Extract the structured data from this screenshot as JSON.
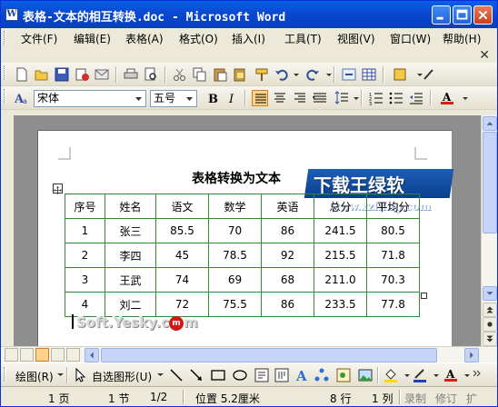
{
  "window": {
    "title": "表格-文本的相互转换.doc - Microsoft Word"
  },
  "menu": [
    "文件(F)",
    "编辑(E)",
    "视图(V)",
    "插入(I)",
    "格式(O)",
    "工具(T)",
    "表格(A)",
    "窗口(W)",
    "帮助(H)"
  ],
  "menu_order": [
    "文件(F)",
    "编辑(E)",
    "表格(A)",
    "格式(O)",
    "插入(I)",
    "工具(T)",
    "视图(V)",
    "窗口(W)",
    "帮助(H)"
  ],
  "formatting": {
    "font": "宋体",
    "size": "五号"
  },
  "document": {
    "heading": "表格转换为文本",
    "table": {
      "headers": [
        "序号",
        "姓名",
        "语文",
        "数学",
        "英语",
        "总分",
        "平均分"
      ],
      "rows": [
        [
          "1",
          "张三",
          "85.5",
          "70",
          "86",
          "241.5",
          "80.5"
        ],
        [
          "2",
          "李四",
          "45",
          "78.5",
          "92",
          "215.5",
          "71.8"
        ],
        [
          "3",
          "王武",
          "74",
          "69",
          "68",
          "211.0",
          "70.3"
        ],
        [
          "4",
          "刘二",
          "72",
          "75.5",
          "86",
          "233.5",
          "77.8"
        ]
      ]
    },
    "watermark_bottom": "Soft.Yesky.c",
    "watermark_bottom_circle": "m",
    "watermark_bottom_tail": "m",
    "banner": "下载王绿软",
    "banner_url": "www.xzlling.com"
  },
  "drawing": {
    "draw_label": "绘图(R)",
    "autoshape_label": "自选图形(U)"
  },
  "status": {
    "page": "1 页",
    "section": "1 节",
    "pages": "1/2",
    "position": "位置 5.2厘米",
    "line": "8 行",
    "column": "1 列",
    "rec": "录制",
    "trk": "修订",
    "ext": "扩"
  },
  "colors": {
    "titlebar": "#0A4BD3",
    "table_border": "#2E8B2E",
    "banner": "#1C5FB8"
  }
}
